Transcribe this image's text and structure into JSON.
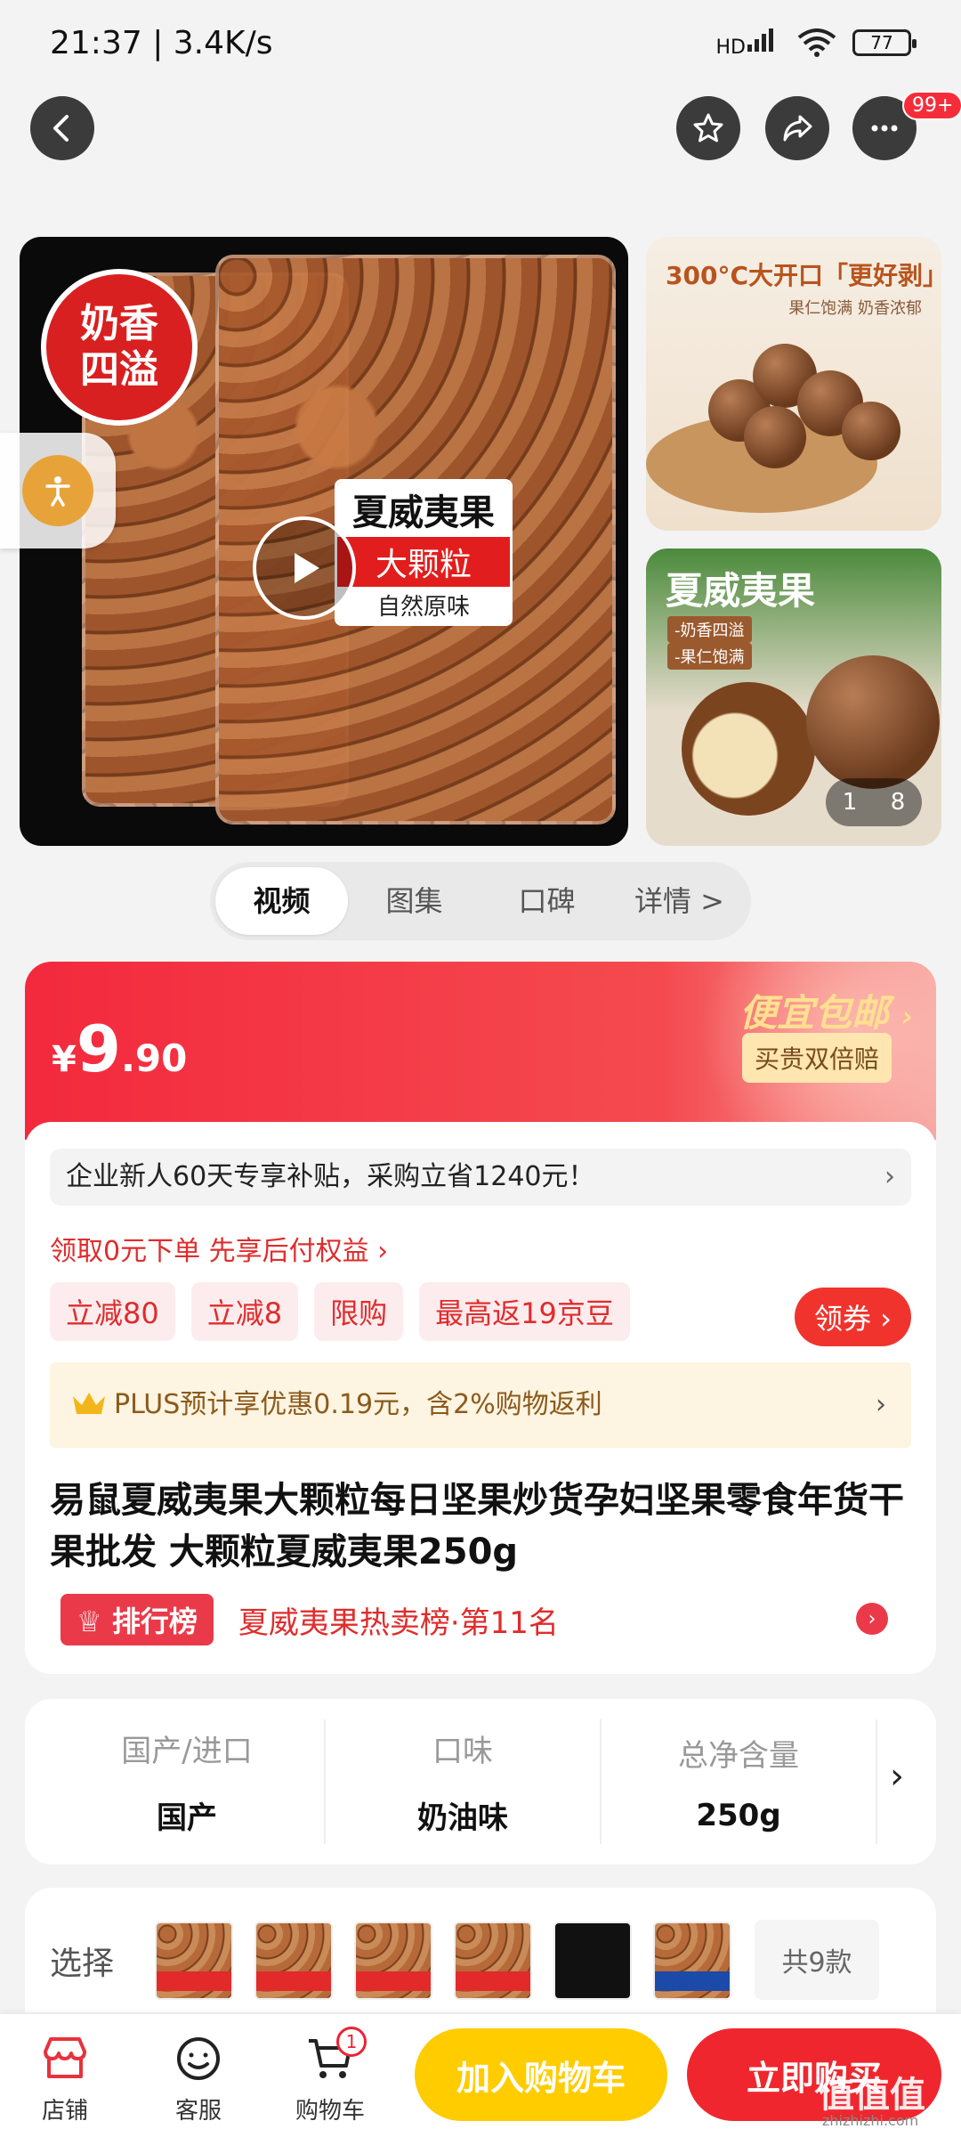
{
  "status_bar": {
    "time": "21:37",
    "speed": "3.4K/s",
    "time_speed": "21:37 | 3.4K/s",
    "signal": "HD",
    "battery": "77"
  },
  "top_nav": {
    "more_badge": "99+"
  },
  "gallery": {
    "seal": [
      "奶香",
      "四溢"
    ],
    "label_line1": "夏威夷果",
    "label_line2": "大颗粒",
    "label_line3": "自然原味",
    "side1_title": "300°C大开口「更好剥」",
    "side1_sub": "果仁饱满 奶香浓郁",
    "side2_title": "夏威夷果",
    "side2_tags": [
      "-奶香四溢",
      "-果仁饱满"
    ],
    "counter_current": "1",
    "counter_total": "8"
  },
  "tabs": [
    "视频",
    "图集",
    "口碑",
    "详情 >"
  ],
  "price": {
    "yen": "¥",
    "int": "9",
    "dec": ".90"
  },
  "promo": {
    "title": "便宜包邮",
    "button": "买贵双倍赔"
  },
  "subsidy": "企业新人60天专享补贴，采购立省1240元！",
  "paylater": "领取0元下单 先享后付权益 ›",
  "tags": [
    "立减80",
    "立减8",
    "限购",
    "最高返19京豆"
  ],
  "coupon_btn": "领券",
  "plus": "PLUS预计享优惠0.19元，含2%购物返利",
  "product_title": "易鼠夏威夷果大颗粒每日坚果炒货孕妇坚果零食年货干果批发 大颗粒夏威夷果250g",
  "rank": {
    "badge": "排行榜",
    "text": "夏威夷果热卖榜·第11名"
  },
  "specs": [
    {
      "k": "国产/进口",
      "v": "国产"
    },
    {
      "k": "口味",
      "v": "奶油味"
    },
    {
      "k": "总净含量",
      "v": "250g"
    }
  ],
  "select": {
    "label": "选择",
    "more": "共9款"
  },
  "bottom": {
    "shop": "店铺",
    "service": "客服",
    "cart": "购物车",
    "cart_count": "1",
    "add_cart": "加入购物车",
    "buy_now": "立即购买"
  },
  "watermark": {
    "text": "值值值",
    "url": "zhizhizhi.com"
  }
}
